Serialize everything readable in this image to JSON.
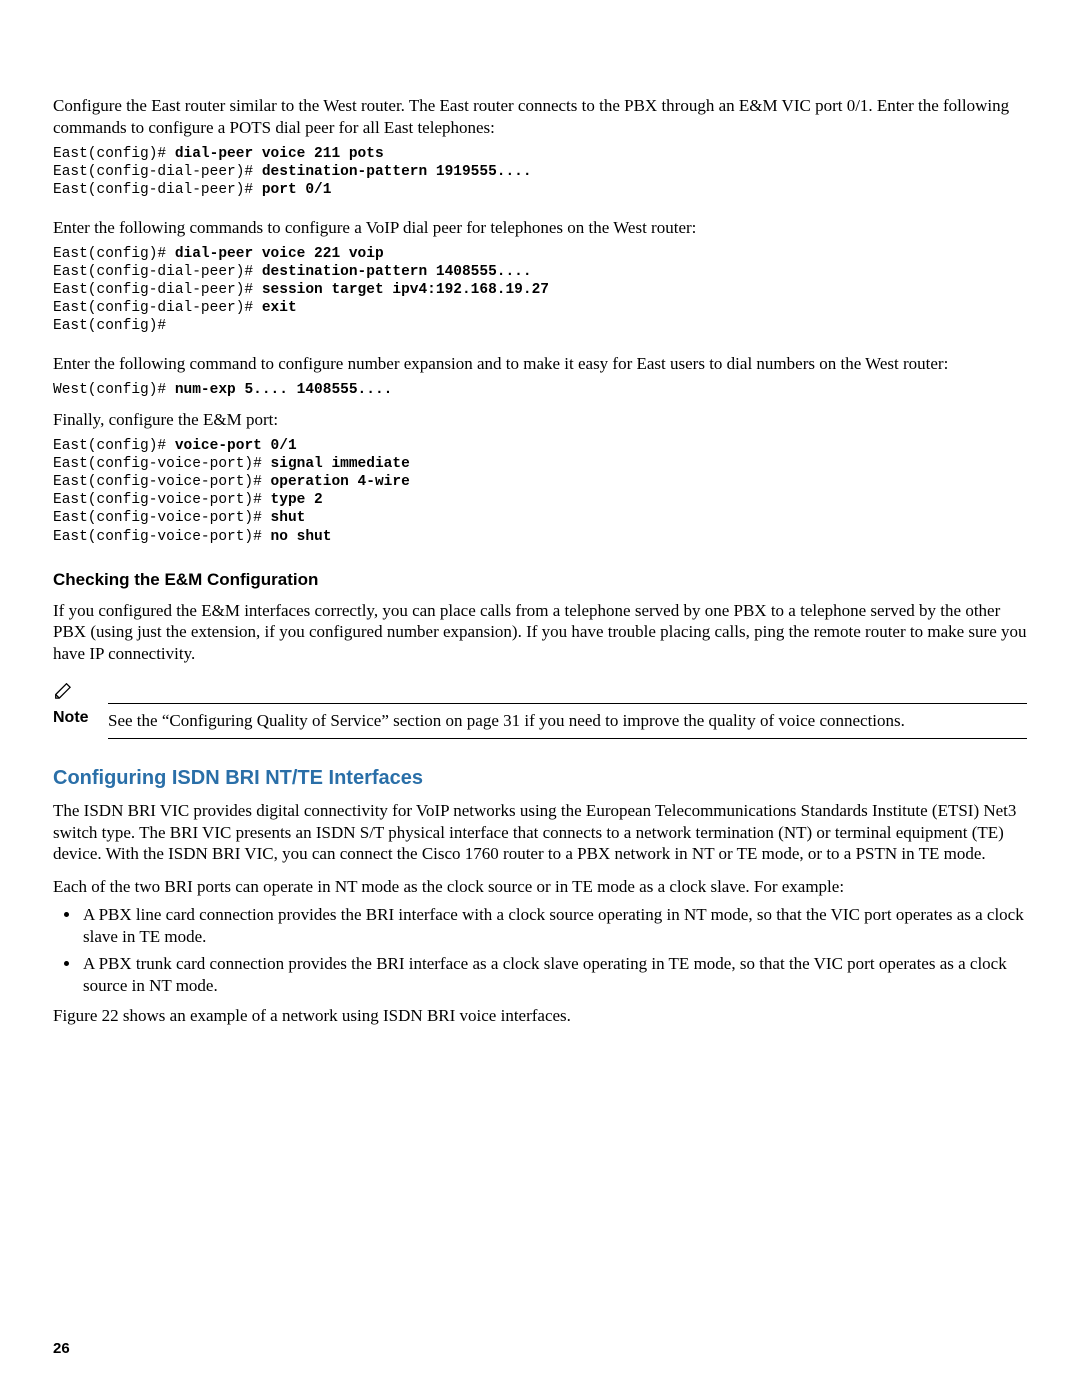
{
  "para1": "Configure the East router similar to the West router. The East router connects to the PBX through an E&M VIC port 0/1. Enter the following commands to configure a POTS dial peer for all East telephones:",
  "code1": {
    "l1p": "East(config)# ",
    "l1b": "dial-peer voice 211 pots",
    "l2p": "East(config-dial-peer)# ",
    "l2b": "destination-pattern 1919555....",
    "l3p": "East(config-dial-peer)# ",
    "l3b": "port 0/1"
  },
  "para2": "Enter the following commands to configure a VoIP dial peer for telephones on the West router:",
  "code2": {
    "l1p": "East(config)# ",
    "l1b": "dial-peer voice 221 voip",
    "l2p": "East(config-dial-peer)# ",
    "l2b": "destination-pattern 1408555....",
    "l3p": "East(config-dial-peer)# ",
    "l3b": "session target ipv4:192.168.19.27",
    "l4p": "East(config-dial-peer)# ",
    "l4b": "exit",
    "l5p": "East(config)#"
  },
  "para3": "Enter the following command to configure number expansion and to make it easy for East users to dial numbers on the West router:",
  "code3": {
    "l1p": "West(config)# ",
    "l1b": "num-exp 5.... 1408555...."
  },
  "para4": "Finally, configure the E&M port:",
  "code4": {
    "l1p": "East(config)# ",
    "l1b": "voice-port 0/1",
    "l2p": "East(config-voice-port)# ",
    "l2b": "signal immediate",
    "l3p": "East(config-voice-port)# ",
    "l3b": "operation 4-wire",
    "l4p": "East(config-voice-port)# ",
    "l4b": "type 2",
    "l5p": "East(config-voice-port)# ",
    "l5b": "shut",
    "l6p": "East(config-voice-port)# ",
    "l6b": "no shut"
  },
  "h3_check": "Checking the E&M Configuration",
  "para5": "If you configured the E&M interfaces correctly, you can place calls from a telephone served by one PBX to a telephone served by the other PBX (using just the extension, if you configured number expansion). If you have trouble placing calls, ping the remote router to make sure you have IP connectivity.",
  "note_label": "Note",
  "note_text": "See the “Configuring Quality of Service” section on page 31 if you need to improve the quality of voice connections.",
  "h2_isdn": "Configuring ISDN BRI NT/TE Interfaces",
  "para6": "The ISDN BRI VIC provides digital connectivity for VoIP networks using the European Telecommunications Standards Institute (ETSI) Net3 switch type. The BRI VIC presents an ISDN S/T physical interface that connects to a network termination (NT) or terminal equipment (TE) device. With the ISDN BRI VIC, you can connect the Cisco 1760 router to a PBX network in NT or TE mode, or to a PSTN in TE mode.",
  "para7": "Each of the two BRI ports can operate in NT mode as the clock source or in TE mode as a clock slave. For example:",
  "bullets": [
    "A PBX line card connection provides the BRI interface with a clock source operating in NT mode, so that the VIC port operates as a clock slave in TE mode.",
    "A PBX trunk card connection provides the BRI interface as a clock slave operating in TE mode, so that the VIC port operates as a clock source in NT mode."
  ],
  "para8": "Figure 22 shows an example of a network using ISDN BRI voice interfaces.",
  "page_number": "26"
}
